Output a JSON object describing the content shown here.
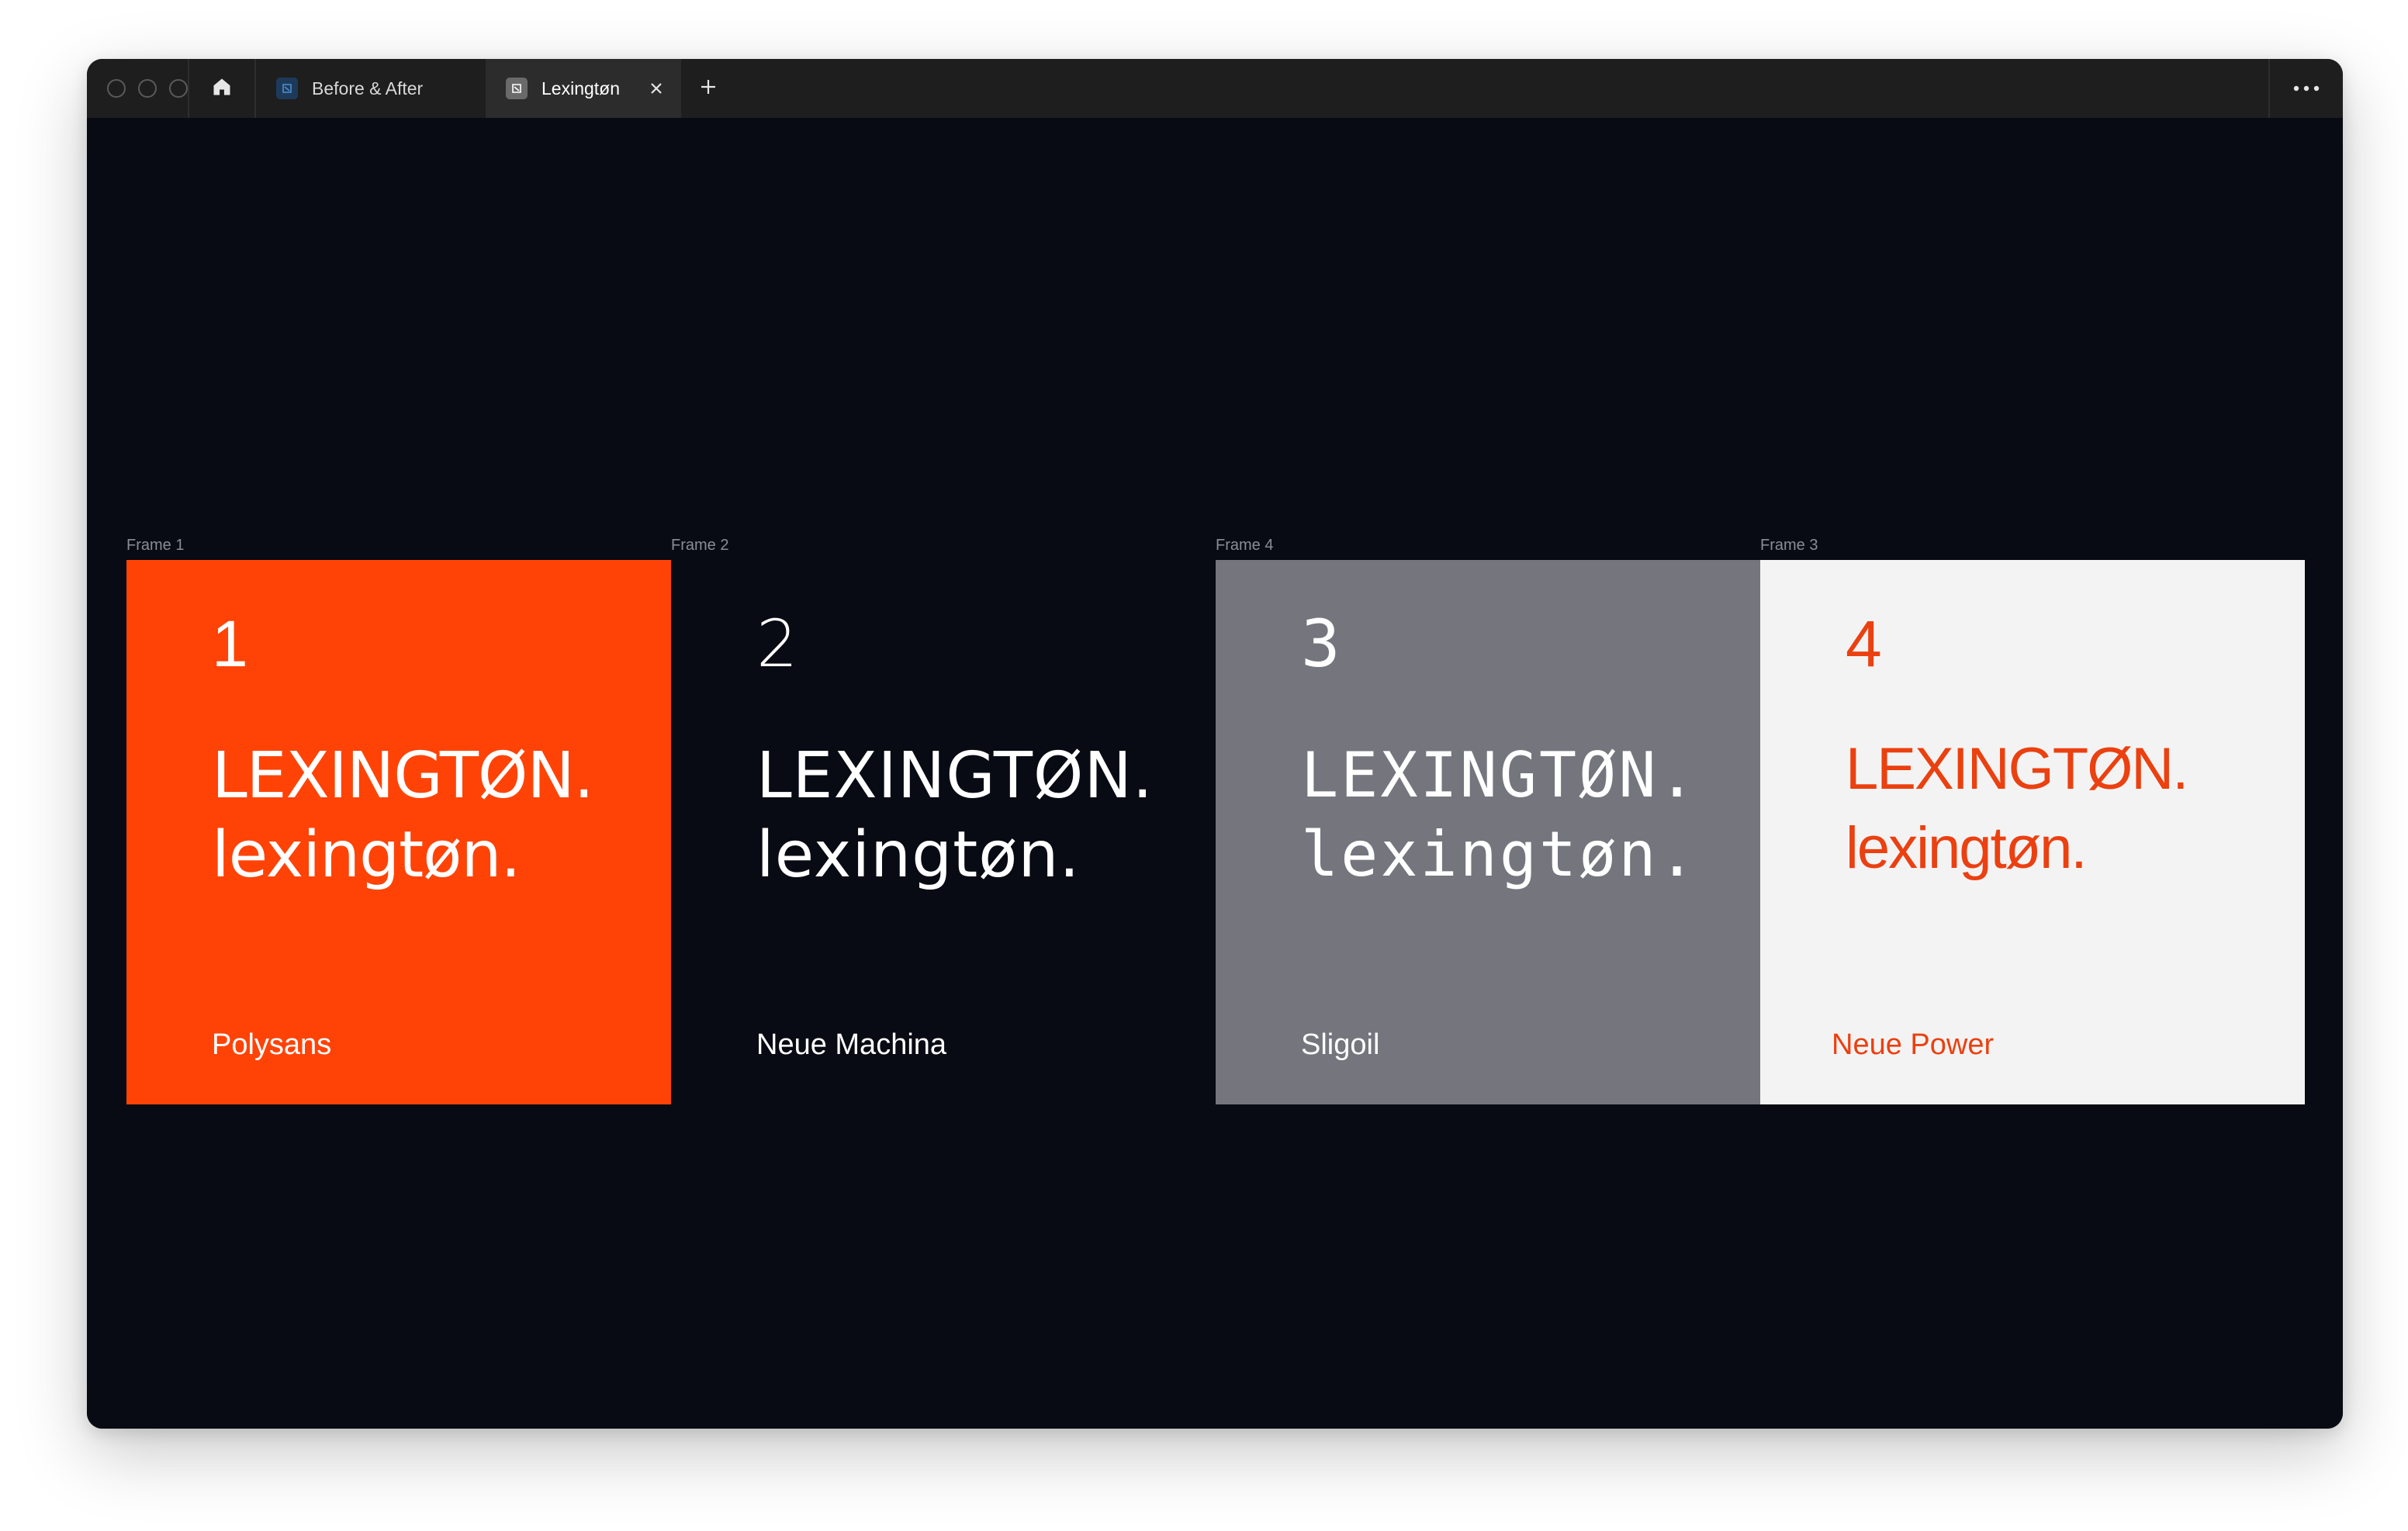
{
  "window": {
    "tabs": [
      {
        "label": "Before & After",
        "icon": "document-icon",
        "active": false
      },
      {
        "label": "Lexingtøn",
        "icon": "document-icon",
        "active": true
      }
    ],
    "home_icon": "home-icon",
    "close_icon": "close-icon",
    "new_tab_icon": "plus-icon",
    "more_icon": "ellipsis-icon"
  },
  "canvas": {
    "background": "#080b13",
    "frames": [
      {
        "label": "Frame 1",
        "number": "1",
        "upper": "LEXINGTØN.",
        "lower": "lexingtøn.",
        "font_name": "Polysans",
        "background": "#ff4307",
        "text_color": "#ffffff"
      },
      {
        "label": "Frame 2",
        "number": "2",
        "upper": "LEXINGTØN.",
        "lower": "lexingtøn.",
        "font_name": "Neue Machina",
        "background": "#080b13",
        "text_color": "#ffffff"
      },
      {
        "label": "Frame 4",
        "number": "3",
        "upper": "LEXINGTØN.",
        "lower": "lexingtøn.",
        "font_name": "Sligoil",
        "background": "#74757d",
        "text_color": "#ffffff"
      },
      {
        "label": "Frame 3",
        "number": "4",
        "upper": "LEXINGTØN.",
        "lower": "lexingtøn.",
        "font_name": "Neue Power",
        "background": "#f3f3f3",
        "text_color": "#eb4010"
      }
    ]
  }
}
